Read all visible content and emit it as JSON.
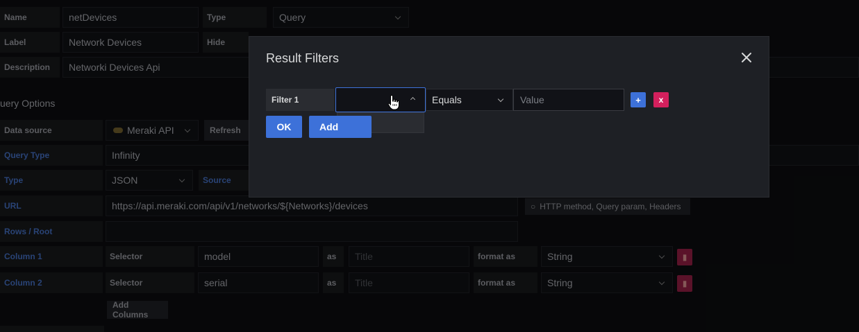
{
  "variable": {
    "name_label": "Name",
    "name_value": "netDevices",
    "type_label": "Type",
    "type_value": "Query",
    "label_label": "Label",
    "label_value": "Network Devices",
    "hide_label": "Hide",
    "description_label": "Description",
    "description_value": "Networki Devices Api"
  },
  "query_options": {
    "title": "uery Options",
    "datasource_label": "Data source",
    "datasource_value": "Meraki API",
    "refresh_label": "Refresh",
    "query_type_label": "Query Type",
    "query_type_value": "Infinity",
    "type_label": "Type",
    "type_value": "JSON",
    "source_label": "Source",
    "url_label": "URL",
    "url_value": "https://api.meraki.com/api/v1/networks/${Networks}/devices",
    "url_hint": "HTTP method, Query param, Headers",
    "rows_root_label": "Rows / Root",
    "columns": [
      {
        "label": "Column 1",
        "selector_label": "Selector",
        "selector_value": "model",
        "as_label": "as",
        "title_placeholder": "Title",
        "format_label": "format as",
        "format_value": "String"
      },
      {
        "label": "Column 2",
        "selector_label": "Selector",
        "selector_value": "serial",
        "as_label": "as",
        "title_placeholder": "Title",
        "format_label": "format as",
        "format_value": "String"
      }
    ],
    "add_columns_label": "Add Columns"
  },
  "modal": {
    "title": "Result Filters",
    "filter_label": "Filter 1",
    "operator_value": "Equals",
    "value_placeholder": "Value",
    "plus_label": "+",
    "remove_label": "x",
    "ok_label": "OK",
    "add_label": "Add"
  },
  "colors": {
    "primary": "#3d71d9",
    "danger": "#d3205d",
    "modal_bg": "#1e2025"
  }
}
